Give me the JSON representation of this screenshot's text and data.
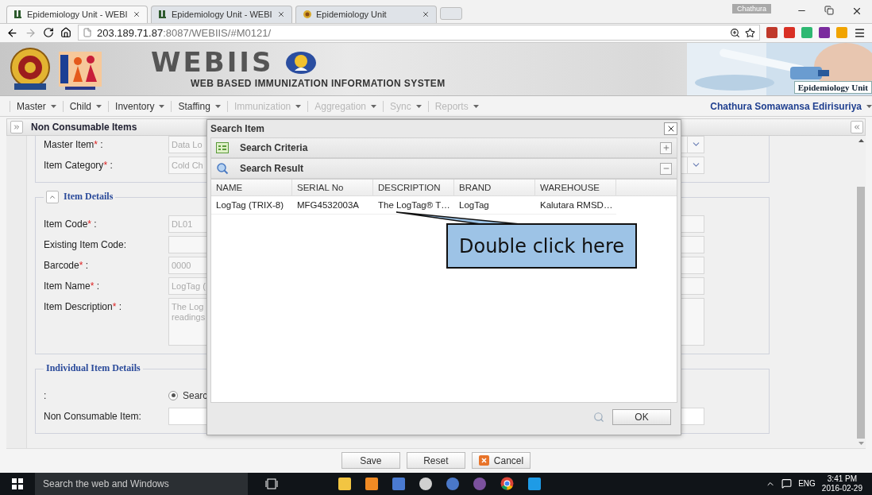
{
  "browser": {
    "tabs": [
      {
        "title": "Epidemiology Unit - WEBI",
        "selected": true
      },
      {
        "title": "Epidemiology Unit - WEBI",
        "selected": false
      },
      {
        "title": "Epidemiology Unit",
        "selected": false
      }
    ],
    "profile": "Chathura",
    "url_host": "203.189.71.87",
    "url_rest": ":8087/WEBIIS/#M0121/"
  },
  "header": {
    "title": "WEBIIS",
    "subtitle": "WEB BASED IMMUNIZATION INFORMATION SYSTEM",
    "unit": "Epidemiology Unit"
  },
  "menu": {
    "items": [
      {
        "label": "Master",
        "disabled": false
      },
      {
        "label": "Child",
        "disabled": false
      },
      {
        "label": "Inventory",
        "disabled": false
      },
      {
        "label": "Staffing",
        "disabled": false
      },
      {
        "label": "Immunization",
        "disabled": true
      },
      {
        "label": "Aggregation",
        "disabled": true
      },
      {
        "label": "Sync",
        "disabled": true
      },
      {
        "label": "Reports",
        "disabled": true
      }
    ],
    "user": "Chathura Somawansa Edirisuriya"
  },
  "panel": {
    "title": "Non Consumable Items"
  },
  "form": {
    "top_rows": [
      {
        "kind": "select",
        "label": "Master Item",
        "mark": "*",
        "colon": ":",
        "value": "Data Lo"
      },
      {
        "kind": "select",
        "label": "Item Category",
        "mark": "*",
        "colon": ":",
        "value": "Cold Ch"
      }
    ],
    "item_details": {
      "legend": "Item Details",
      "expanded": true,
      "rows": [
        {
          "kind": "text",
          "label": "Item Code",
          "mark": "*",
          "colon": ":",
          "value": "DL01"
        },
        {
          "kind": "text",
          "label": "Existing Item Code:"
        },
        {
          "kind": "text",
          "label": "Barcode",
          "mark": "*",
          "colon": ":",
          "value": "0000"
        },
        {
          "kind": "text",
          "label": "Item Name",
          "mark": "*",
          "colon": ":",
          "value": "LogTag ("
        },
        {
          "kind": "textarea",
          "label": "Item Description",
          "mark": "*",
          "colon": ":",
          "lines": [
            "The Log",
            "readings"
          ]
        }
      ]
    },
    "individual": {
      "legend": "Individual Item Details",
      "rows": [
        {
          "kind": "radio",
          "label": ":",
          "option": "Searc",
          "selected": true
        },
        {
          "kind": "input",
          "label": "Non Consumable Item:"
        }
      ]
    }
  },
  "dialog": {
    "title": "Search Item",
    "sections": [
      {
        "title": "Search Criteria",
        "kind": "criteria",
        "expanded": false
      },
      {
        "title": "Search Result",
        "kind": "result",
        "expanded": true
      }
    ],
    "columns": [
      "NAME",
      "SERIAL No",
      "DESCRIPTION",
      "BRAND",
      "WAREHOUSE"
    ],
    "rows": [
      [
        "LogTag (TRIX-8)",
        "MFG4532003A",
        "The LogTag® T…",
        "LogTag",
        "Kalutara RMSD…"
      ]
    ],
    "ok": "OK"
  },
  "callout": "Double click here",
  "actions": [
    {
      "label": "Save",
      "kind": "plain"
    },
    {
      "label": "Reset",
      "kind": "plain"
    },
    {
      "label": "Cancel",
      "kind": "cancel"
    }
  ],
  "taskbar": {
    "search_placeholder": "Search the web and Windows",
    "language": "ENG",
    "time": "3:41 PM",
    "date": "2016-02-29"
  }
}
